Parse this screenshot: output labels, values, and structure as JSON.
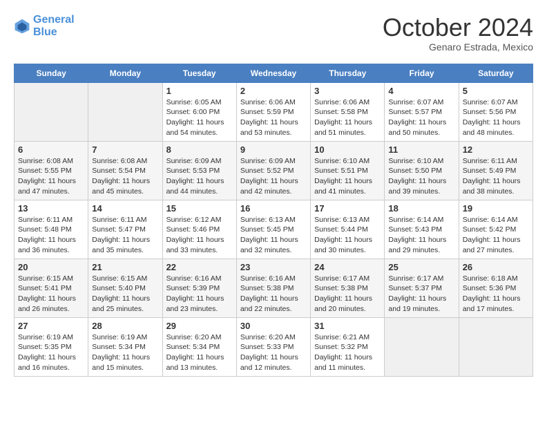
{
  "header": {
    "logo_line1": "General",
    "logo_line2": "Blue",
    "month": "October 2024",
    "location": "Genaro Estrada, Mexico"
  },
  "weekdays": [
    "Sunday",
    "Monday",
    "Tuesday",
    "Wednesday",
    "Thursday",
    "Friday",
    "Saturday"
  ],
  "weeks": [
    [
      {
        "day": "",
        "empty": true
      },
      {
        "day": "",
        "empty": true
      },
      {
        "day": "1",
        "sunrise": "6:05 AM",
        "sunset": "6:00 PM",
        "daylight": "11 hours and 54 minutes."
      },
      {
        "day": "2",
        "sunrise": "6:06 AM",
        "sunset": "5:59 PM",
        "daylight": "11 hours and 53 minutes."
      },
      {
        "day": "3",
        "sunrise": "6:06 AM",
        "sunset": "5:58 PM",
        "daylight": "11 hours and 51 minutes."
      },
      {
        "day": "4",
        "sunrise": "6:07 AM",
        "sunset": "5:57 PM",
        "daylight": "11 hours and 50 minutes."
      },
      {
        "day": "5",
        "sunrise": "6:07 AM",
        "sunset": "5:56 PM",
        "daylight": "11 hours and 48 minutes."
      }
    ],
    [
      {
        "day": "6",
        "sunrise": "6:08 AM",
        "sunset": "5:55 PM",
        "daylight": "11 hours and 47 minutes."
      },
      {
        "day": "7",
        "sunrise": "6:08 AM",
        "sunset": "5:54 PM",
        "daylight": "11 hours and 45 minutes."
      },
      {
        "day": "8",
        "sunrise": "6:09 AM",
        "sunset": "5:53 PM",
        "daylight": "11 hours and 44 minutes."
      },
      {
        "day": "9",
        "sunrise": "6:09 AM",
        "sunset": "5:52 PM",
        "daylight": "11 hours and 42 minutes."
      },
      {
        "day": "10",
        "sunrise": "6:10 AM",
        "sunset": "5:51 PM",
        "daylight": "11 hours and 41 minutes."
      },
      {
        "day": "11",
        "sunrise": "6:10 AM",
        "sunset": "5:50 PM",
        "daylight": "11 hours and 39 minutes."
      },
      {
        "day": "12",
        "sunrise": "6:11 AM",
        "sunset": "5:49 PM",
        "daylight": "11 hours and 38 minutes."
      }
    ],
    [
      {
        "day": "13",
        "sunrise": "6:11 AM",
        "sunset": "5:48 PM",
        "daylight": "11 hours and 36 minutes."
      },
      {
        "day": "14",
        "sunrise": "6:11 AM",
        "sunset": "5:47 PM",
        "daylight": "11 hours and 35 minutes."
      },
      {
        "day": "15",
        "sunrise": "6:12 AM",
        "sunset": "5:46 PM",
        "daylight": "11 hours and 33 minutes."
      },
      {
        "day": "16",
        "sunrise": "6:13 AM",
        "sunset": "5:45 PM",
        "daylight": "11 hours and 32 minutes."
      },
      {
        "day": "17",
        "sunrise": "6:13 AM",
        "sunset": "5:44 PM",
        "daylight": "11 hours and 30 minutes."
      },
      {
        "day": "18",
        "sunrise": "6:14 AM",
        "sunset": "5:43 PM",
        "daylight": "11 hours and 29 minutes."
      },
      {
        "day": "19",
        "sunrise": "6:14 AM",
        "sunset": "5:42 PM",
        "daylight": "11 hours and 27 minutes."
      }
    ],
    [
      {
        "day": "20",
        "sunrise": "6:15 AM",
        "sunset": "5:41 PM",
        "daylight": "11 hours and 26 minutes."
      },
      {
        "day": "21",
        "sunrise": "6:15 AM",
        "sunset": "5:40 PM",
        "daylight": "11 hours and 25 minutes."
      },
      {
        "day": "22",
        "sunrise": "6:16 AM",
        "sunset": "5:39 PM",
        "daylight": "11 hours and 23 minutes."
      },
      {
        "day": "23",
        "sunrise": "6:16 AM",
        "sunset": "5:38 PM",
        "daylight": "11 hours and 22 minutes."
      },
      {
        "day": "24",
        "sunrise": "6:17 AM",
        "sunset": "5:38 PM",
        "daylight": "11 hours and 20 minutes."
      },
      {
        "day": "25",
        "sunrise": "6:17 AM",
        "sunset": "5:37 PM",
        "daylight": "11 hours and 19 minutes."
      },
      {
        "day": "26",
        "sunrise": "6:18 AM",
        "sunset": "5:36 PM",
        "daylight": "11 hours and 17 minutes."
      }
    ],
    [
      {
        "day": "27",
        "sunrise": "6:19 AM",
        "sunset": "5:35 PM",
        "daylight": "11 hours and 16 minutes."
      },
      {
        "day": "28",
        "sunrise": "6:19 AM",
        "sunset": "5:34 PM",
        "daylight": "11 hours and 15 minutes."
      },
      {
        "day": "29",
        "sunrise": "6:20 AM",
        "sunset": "5:34 PM",
        "daylight": "11 hours and 13 minutes."
      },
      {
        "day": "30",
        "sunrise": "6:20 AM",
        "sunset": "5:33 PM",
        "daylight": "11 hours and 12 minutes."
      },
      {
        "day": "31",
        "sunrise": "6:21 AM",
        "sunset": "5:32 PM",
        "daylight": "11 hours and 11 minutes."
      },
      {
        "day": "",
        "empty": true
      },
      {
        "day": "",
        "empty": true
      }
    ]
  ],
  "labels": {
    "sunrise_prefix": "Sunrise: ",
    "sunset_prefix": "Sunset: ",
    "daylight_prefix": "Daylight: "
  }
}
